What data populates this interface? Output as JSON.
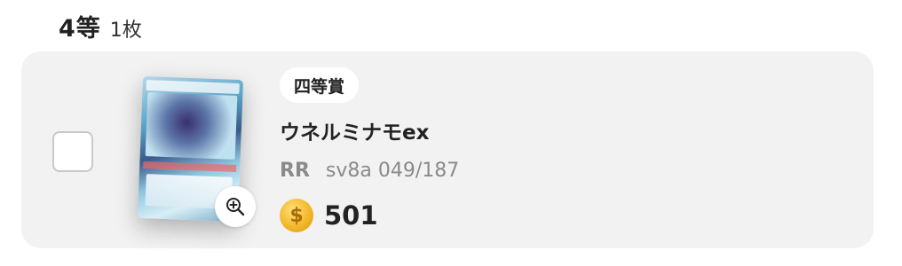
{
  "section": {
    "tier": "4等",
    "count": "1枚"
  },
  "item": {
    "tag": "四等賞",
    "name": "ウネルミナモex",
    "rarity": "RR",
    "set_code": "sv8a 049/187",
    "price": "501",
    "coin_symbol": "$",
    "card_image_icon": "card-image",
    "zoom_icon": "zoom-in-icon"
  }
}
